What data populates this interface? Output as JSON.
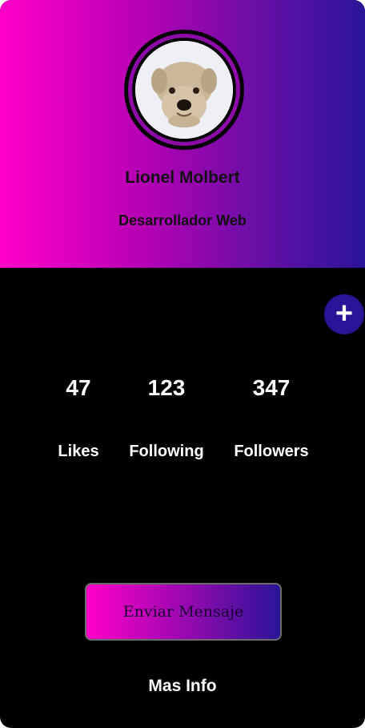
{
  "profile": {
    "name": "Lionel Molbert",
    "role": "Desarrollador Web"
  },
  "stats": [
    {
      "value": "47",
      "label": "Likes"
    },
    {
      "value": "123",
      "label": "Following"
    },
    {
      "value": "347",
      "label": "Followers"
    }
  ],
  "actions": {
    "add_icon": "plus-icon",
    "send_label": "Enviar Mensaje",
    "more_label": "Mas Info"
  },
  "colors": {
    "gradient_start": "#ff00c8",
    "gradient_end": "#2a1597",
    "accent": "#2a1597",
    "background": "#000000"
  }
}
